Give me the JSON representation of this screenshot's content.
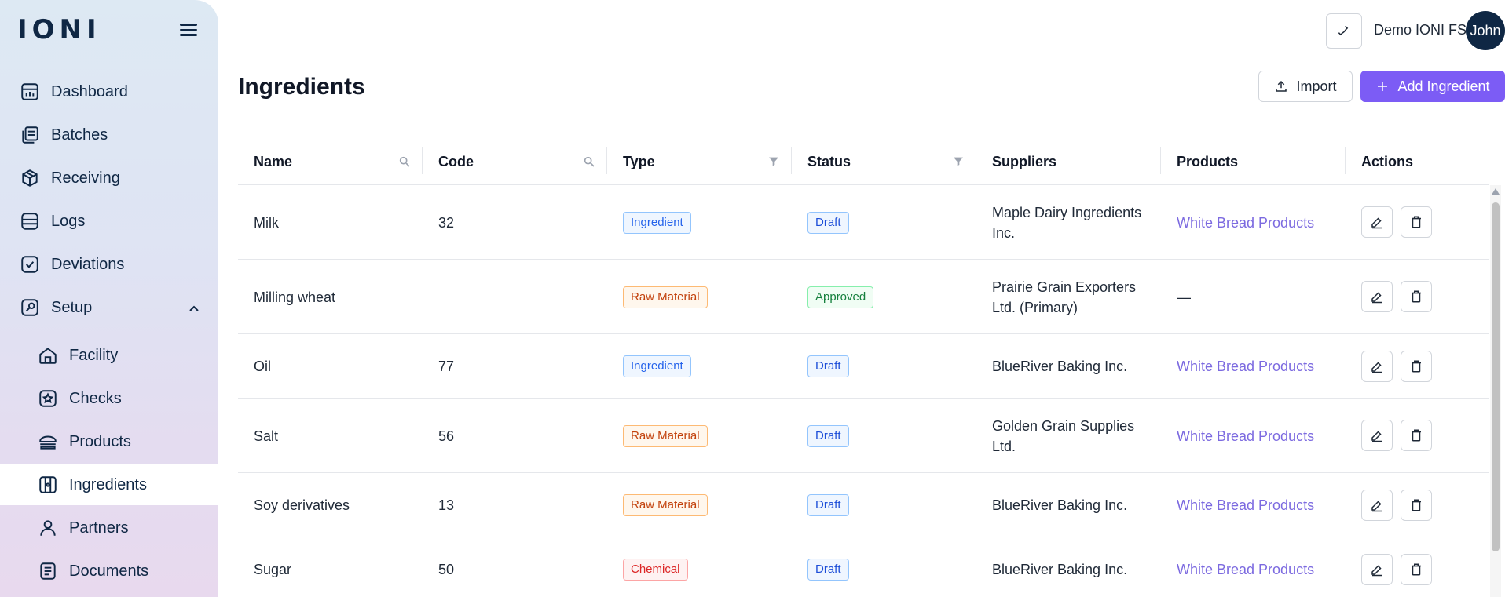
{
  "app": {
    "logo": "IONI"
  },
  "sidebar": {
    "items": [
      {
        "label": "Dashboard",
        "icon": "dashboard-icon"
      },
      {
        "label": "Batches",
        "icon": "batches-icon"
      },
      {
        "label": "Receiving",
        "icon": "package-icon"
      },
      {
        "label": "Logs",
        "icon": "logs-icon"
      },
      {
        "label": "Deviations",
        "icon": "checkbox-icon"
      },
      {
        "label": "Setup",
        "icon": "setup-icon",
        "expanded": true
      }
    ],
    "setup_items": [
      {
        "label": "Facility",
        "icon": "home-icon"
      },
      {
        "label": "Checks",
        "icon": "star-badge-icon"
      },
      {
        "label": "Products",
        "icon": "bread-icon"
      },
      {
        "label": "Ingredients",
        "icon": "ingredients-icon",
        "active": true
      },
      {
        "label": "Partners",
        "icon": "user-icon"
      },
      {
        "label": "Documents",
        "icon": "document-icon"
      }
    ]
  },
  "topbar": {
    "user_name": "Demo IONI FS",
    "avatar_text": "John"
  },
  "header": {
    "title": "Ingredients",
    "import_label": "Import",
    "add_label": "Add Ingredient"
  },
  "table": {
    "columns": [
      "Name",
      "Code",
      "Type",
      "Status",
      "Suppliers",
      "Products",
      "Actions"
    ],
    "rows": [
      {
        "name": "Milk",
        "code": "32",
        "type": "Ingredient",
        "status": "Draft",
        "supplier": "Maple Dairy Ingredients Inc.",
        "products": "White Bread Products"
      },
      {
        "name": "Milling wheat",
        "code": "",
        "type": "Raw Material",
        "status": "Approved",
        "supplier": "Prairie Grain Exporters Ltd. (Primary)",
        "products": "—"
      },
      {
        "name": "Oil",
        "code": "77",
        "type": "Ingredient",
        "status": "Draft",
        "supplier": "BlueRiver Baking Inc.",
        "products": "White Bread Products"
      },
      {
        "name": "Salt",
        "code": "56",
        "type": "Raw Material",
        "status": "Draft",
        "supplier": "Golden Grain Supplies Ltd.",
        "products": "White Bread Products"
      },
      {
        "name": "Soy derivatives",
        "code": "13",
        "type": "Raw Material",
        "status": "Draft",
        "supplier": "BlueRiver Baking Inc.",
        "products": "White Bread Products"
      },
      {
        "name": "Sugar",
        "code": "50",
        "type": "Chemical",
        "status": "Draft",
        "supplier": "BlueRiver Baking Inc.",
        "products": "White Bread Products"
      }
    ]
  },
  "colors": {
    "accent": "#7c5cf5",
    "navy": "#0f2744",
    "link": "#7c6ae0"
  }
}
